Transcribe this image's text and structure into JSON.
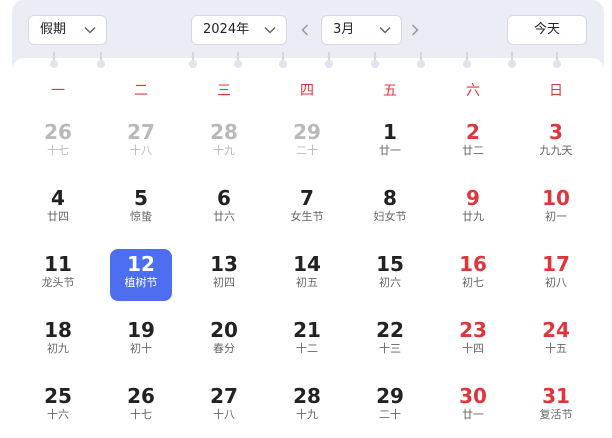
{
  "toolbar": {
    "holiday_select": "假期",
    "year_select": "2024年",
    "month_select": "3月",
    "today_button": "今天"
  },
  "weekdays": [
    "一",
    "二",
    "三",
    "四",
    "五",
    "六",
    "日"
  ],
  "weeks": [
    [
      {
        "day": "26",
        "lunar": "十七",
        "other": true
      },
      {
        "day": "27",
        "lunar": "十八",
        "other": true
      },
      {
        "day": "28",
        "lunar": "十九",
        "other": true
      },
      {
        "day": "29",
        "lunar": "二十",
        "other": true
      },
      {
        "day": "1",
        "lunar": "廿一"
      },
      {
        "day": "2",
        "lunar": "廿二",
        "weekend": true
      },
      {
        "day": "3",
        "lunar": "九九天",
        "weekend": true
      }
    ],
    [
      {
        "day": "4",
        "lunar": "廿四"
      },
      {
        "day": "5",
        "lunar": "惊蛰"
      },
      {
        "day": "6",
        "lunar": "廿六"
      },
      {
        "day": "7",
        "lunar": "女生节"
      },
      {
        "day": "8",
        "lunar": "妇女节"
      },
      {
        "day": "9",
        "lunar": "廿九",
        "weekend": true
      },
      {
        "day": "10",
        "lunar": "初一",
        "weekend": true
      }
    ],
    [
      {
        "day": "11",
        "lunar": "龙头节"
      },
      {
        "day": "12",
        "lunar": "植树节",
        "selected": true
      },
      {
        "day": "13",
        "lunar": "初四"
      },
      {
        "day": "14",
        "lunar": "初五"
      },
      {
        "day": "15",
        "lunar": "初六"
      },
      {
        "day": "16",
        "lunar": "初七",
        "weekend": true
      },
      {
        "day": "17",
        "lunar": "初八",
        "weekend": true
      }
    ],
    [
      {
        "day": "18",
        "lunar": "初九"
      },
      {
        "day": "19",
        "lunar": "初十"
      },
      {
        "day": "20",
        "lunar": "春分"
      },
      {
        "day": "21",
        "lunar": "十二"
      },
      {
        "day": "22",
        "lunar": "十三"
      },
      {
        "day": "23",
        "lunar": "十四",
        "weekend": true
      },
      {
        "day": "24",
        "lunar": "十五",
        "weekend": true
      }
    ],
    [
      {
        "day": "25",
        "lunar": "十六"
      },
      {
        "day": "26",
        "lunar": "十七"
      },
      {
        "day": "27",
        "lunar": "十八"
      },
      {
        "day": "28",
        "lunar": "十九"
      },
      {
        "day": "29",
        "lunar": "二十"
      },
      {
        "day": "30",
        "lunar": "廿一",
        "weekend": true
      },
      {
        "day": "31",
        "lunar": "复活节",
        "weekend": true
      }
    ]
  ],
  "colors": {
    "weekend_red": "#e0353d",
    "selected_blue": "#4e6ef2",
    "other_month_gray": "#b9b9b9"
  }
}
